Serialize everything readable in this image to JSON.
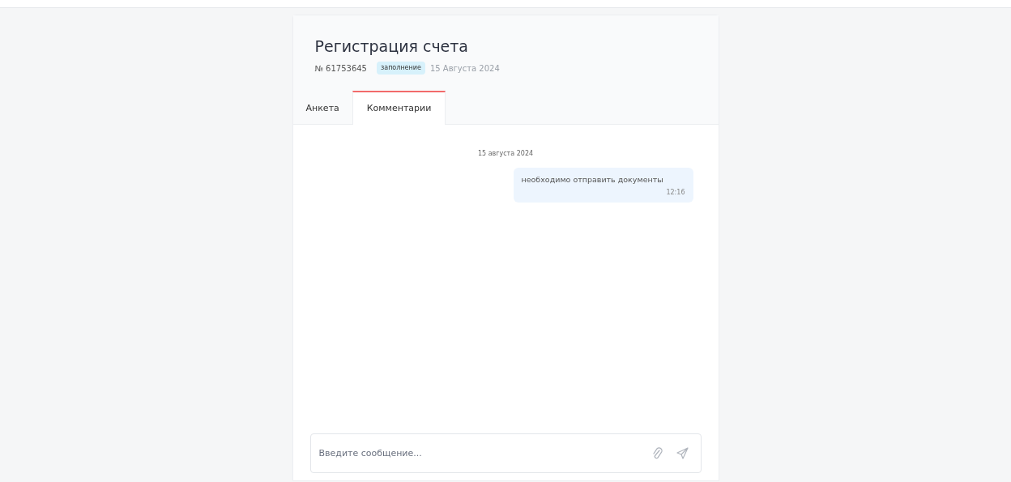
{
  "header": {
    "title": "Регистрация счета",
    "number": "№ 61753645",
    "status_badge": "заполнение",
    "date": "15 Августа 2024"
  },
  "tabs": [
    {
      "label": "Анкета",
      "selected": false
    },
    {
      "label": "Комментарии",
      "selected": true
    }
  ],
  "chat": {
    "date_separator": "15 августа 2024",
    "messages": [
      {
        "text": "необходимо отправить документы",
        "time": "12:16",
        "outgoing": true
      }
    ]
  },
  "composer": {
    "placeholder": "Введите сообщение..."
  }
}
